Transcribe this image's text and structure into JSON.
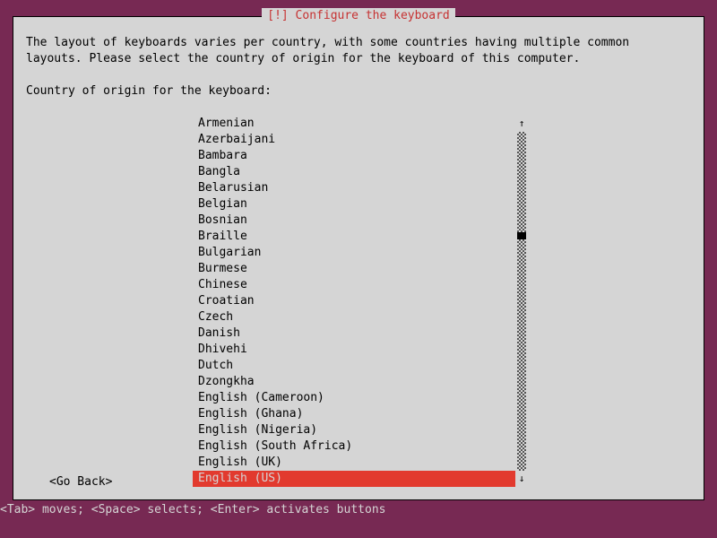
{
  "dialog": {
    "title": " [!] Configure the keyboard ",
    "description": "The layout of keyboards varies per country, with some countries having multiple common\nlayouts. Please select the country of origin for the keyboard of this computer.",
    "prompt": "Country of origin for the keyboard:",
    "items": [
      "Armenian",
      "Azerbaijani",
      "Bambara",
      "Bangla",
      "Belarusian",
      "Belgian",
      "Bosnian",
      "Braille",
      "Bulgarian",
      "Burmese",
      "Chinese",
      "Croatian",
      "Czech",
      "Danish",
      "Dhivehi",
      "Dutch",
      "Dzongkha",
      "English (Cameroon)",
      "English (Ghana)",
      "English (Nigeria)",
      "English (South Africa)",
      "English (UK)",
      "English (US)"
    ],
    "selected_index": 22,
    "go_back": "Go Back"
  },
  "hint": "<Tab> moves; <Space> selects; <Enter> activates buttons"
}
